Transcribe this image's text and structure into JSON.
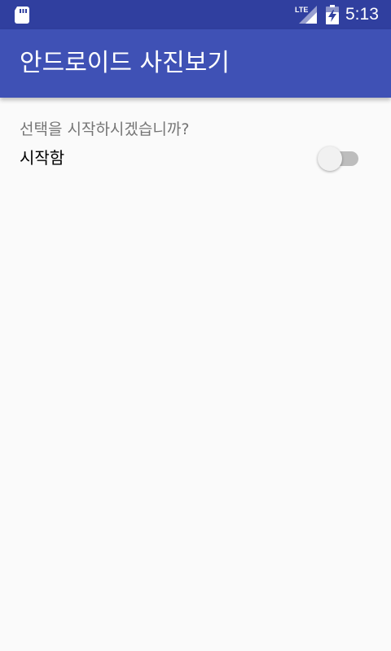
{
  "status_bar": {
    "time": "5:13",
    "network_label": "LTE",
    "icons": [
      "sd-card-icon",
      "lte-signal-icon",
      "battery-icon"
    ],
    "color": "#303f9f"
  },
  "app_bar": {
    "title": "안드로이드 사진보기",
    "color": "#3f51b5"
  },
  "main": {
    "question": "선택을 시작하시겠습니까?",
    "switch_label": "시작함",
    "switch_checked": false
  }
}
